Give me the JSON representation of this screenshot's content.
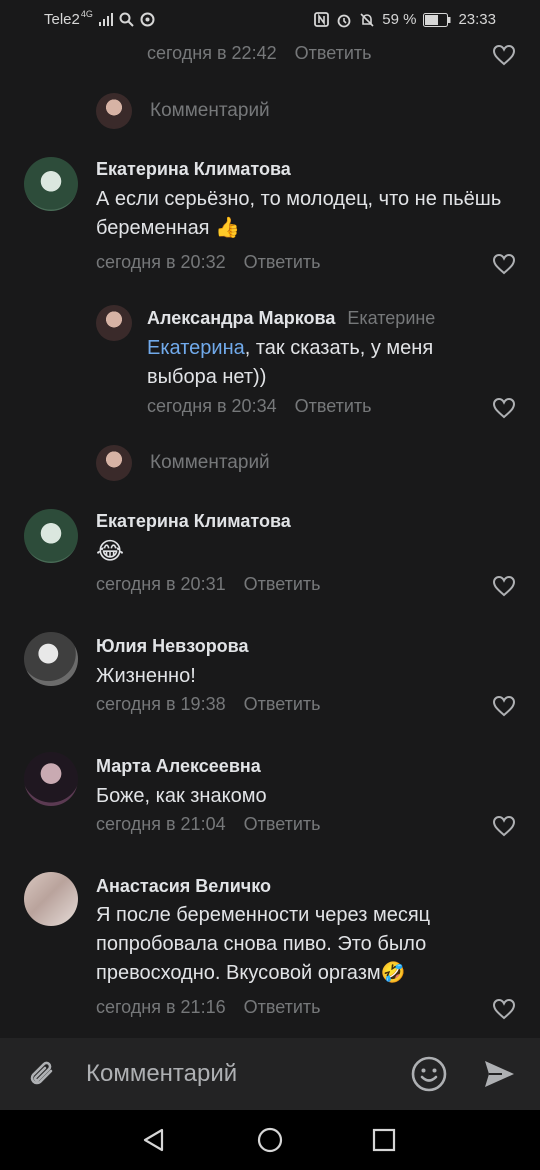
{
  "status_bar": {
    "carrier": "Tele2",
    "network": "4G",
    "battery_percent": "59 %",
    "time": "23:33"
  },
  "comments": [
    {
      "meta_time": "сегодня в 22:42",
      "reply_label": "Ответить"
    },
    {
      "composer_placeholder": "Комментарий"
    },
    {
      "author": "Екатерина Климатова",
      "text": "А если серьёзно, то молодец, что не пьёшь беременная",
      "emoji": "👍",
      "meta_time": "сегодня в 20:32",
      "reply_label": "Ответить"
    },
    {
      "author": "Александра Маркова",
      "addressee": "Екатерине",
      "mention": "Екатерина",
      "text": ", так сказать, у меня выбора нет))",
      "meta_time": "сегодня в 20:34",
      "reply_label": "Ответить"
    },
    {
      "composer_placeholder": "Комментарий"
    },
    {
      "author": "Екатерина Климатова",
      "emoji": "😂",
      "meta_time": "сегодня в 20:31",
      "reply_label": "Ответить"
    },
    {
      "author": "Юлия Невзорова",
      "text": "Жизненно!",
      "meta_time": "сегодня в 19:38",
      "reply_label": "Ответить"
    },
    {
      "author": "Марта Алексеевна",
      "text": "Боже, как знакомо",
      "meta_time": "сегодня в 21:04",
      "reply_label": "Ответить"
    },
    {
      "author": "Анастасия Величко",
      "text_line1": "Я после беременности через месяц",
      "text_line2": "попробовала снова пиво. Это было",
      "text_line3": "превосходно. Вкусовой оргазм",
      "emoji": "🤣",
      "meta_time": "сегодня в 21:16",
      "reply_label": "Ответить"
    }
  ],
  "composer": {
    "placeholder": "Комментарий"
  },
  "colors": {
    "background": "#19191a",
    "link": "#71aaeb",
    "muted": "#76787a"
  }
}
